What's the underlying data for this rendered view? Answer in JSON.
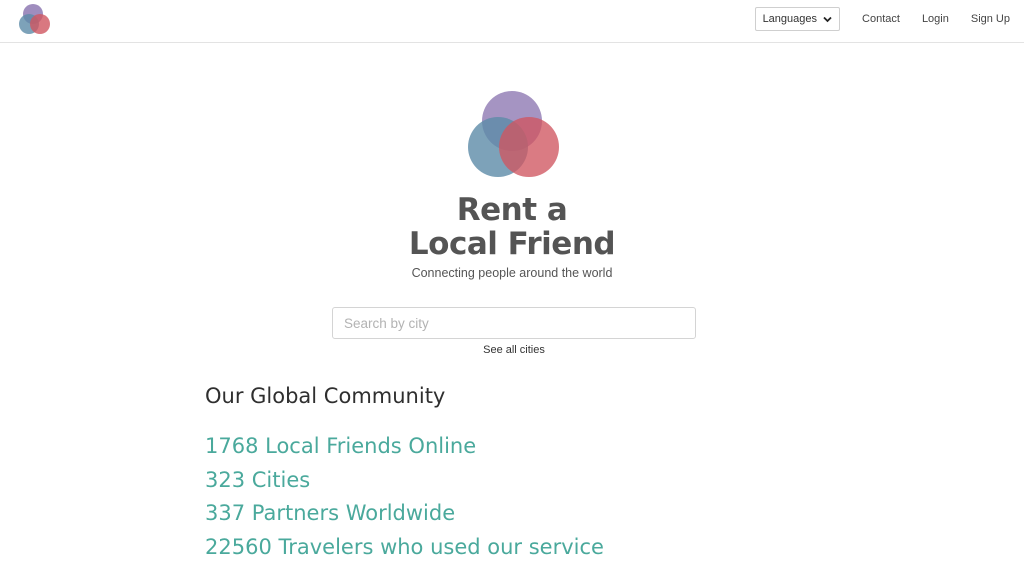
{
  "nav": {
    "languages_label": "Languages",
    "contact_label": "Contact",
    "login_label": "Login",
    "signup_label": "Sign Up"
  },
  "brand": {
    "title_line1": "Rent a",
    "title_line2": "Local Friend",
    "tagline": "Connecting people around the world",
    "colors": {
      "purple": "#8e79b3",
      "blue": "#5c8ba8",
      "red": "#cf5660"
    }
  },
  "search": {
    "placeholder": "Search by city",
    "value": "",
    "see_all_label": "See all cities"
  },
  "community": {
    "title": "Our Global Community",
    "stats": [
      "1768 Local Friends Online",
      "323 Cities",
      "337 Partners Worldwide",
      "22560 Travelers who used our service"
    ],
    "accent_color": "#4aa99c"
  }
}
